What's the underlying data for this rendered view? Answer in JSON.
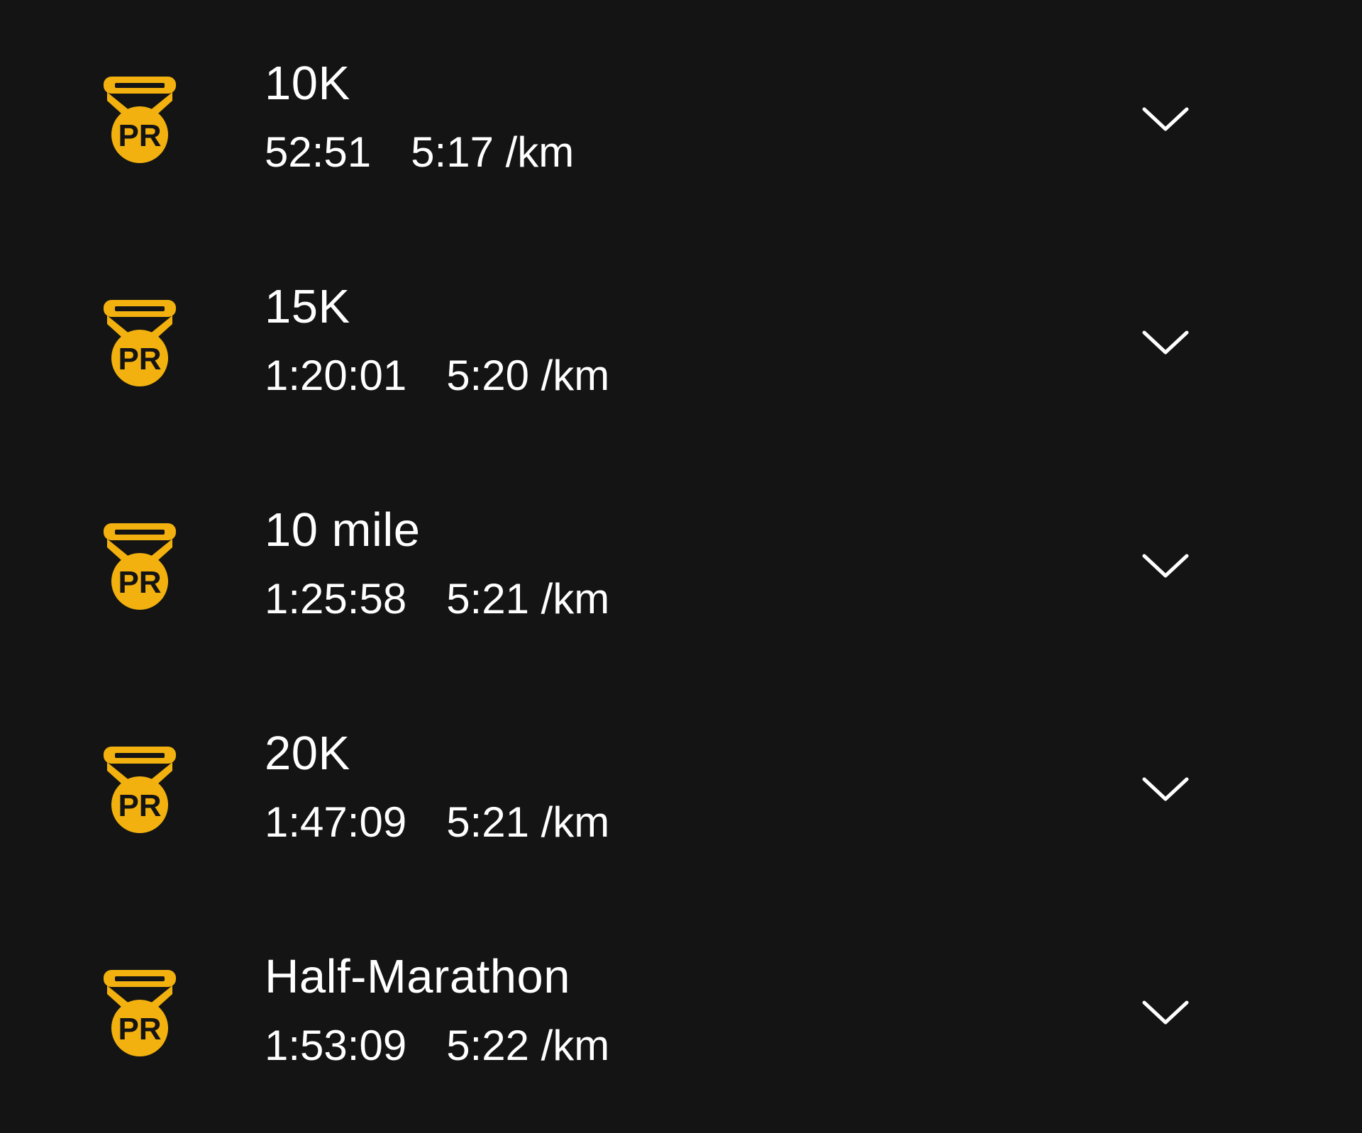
{
  "colors": {
    "background": "#141414",
    "text": "#ffffff",
    "badge": "#F2B10E",
    "badge_ink": "#141414"
  },
  "badge": {
    "icon": "pr-medal-icon",
    "label": "PR"
  },
  "records": [
    {
      "distance": "10K",
      "time": "52:51",
      "pace": "5:17 /km"
    },
    {
      "distance": "15K",
      "time": "1:20:01",
      "pace": "5:20 /km"
    },
    {
      "distance": "10 mile",
      "time": "1:25:58",
      "pace": "5:21 /km"
    },
    {
      "distance": "20K",
      "time": "1:47:09",
      "pace": "5:21 /km"
    },
    {
      "distance": "Half-Marathon",
      "time": "1:53:09",
      "pace": "5:22 /km"
    }
  ]
}
